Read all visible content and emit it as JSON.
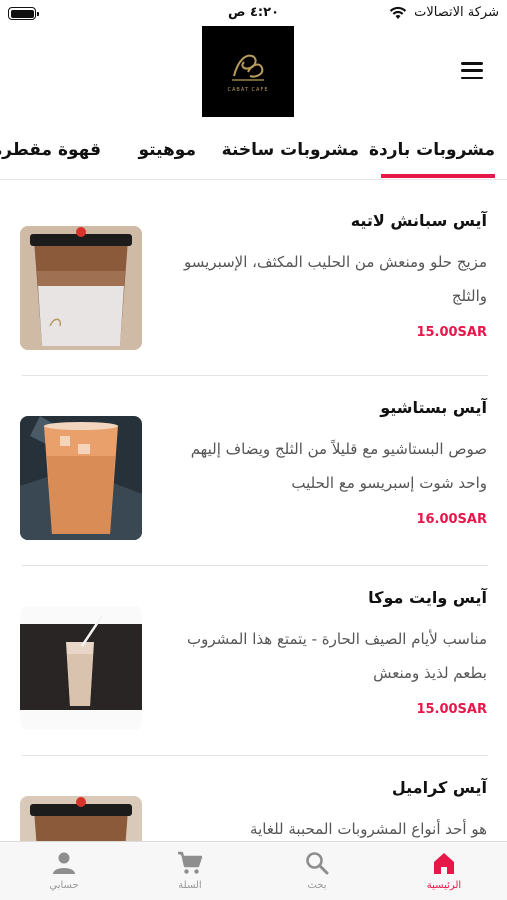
{
  "status_bar": {
    "carrier": "شركة الاتصالات",
    "time": "٤:٢٠ ص"
  },
  "header": {
    "logo_text": "CABAT CAFE",
    "menu_icon": "hamburger-menu-icon"
  },
  "tabs": [
    {
      "label": "مشروبات باردة",
      "active": true
    },
    {
      "label": "مشروبات ساخنة",
      "active": false
    },
    {
      "label": "موهيتو",
      "active": false
    },
    {
      "label": "قهوة مقطرة",
      "active": false
    }
  ],
  "products": [
    {
      "title": "آيس سبانش لاتيه",
      "description": "مزيج حلو ومنعش من الحليب المكثف، الإسبريسو والثلج",
      "price": "15.00SAR"
    },
    {
      "title": "آيس بستاشيو",
      "description": "صوص البستاشيو مع قليلاً من الثلج ويضاف إليهم واحد شوت إسبريسو مع الحليب",
      "price": "16.00SAR"
    },
    {
      "title": "آيس وايت موكا",
      "description": "مناسب لأيام الصيف الحارة - يتمتع هذا المشروب بطعم لذيذ ومنعش",
      "price": "15.00SAR"
    },
    {
      "title": "آيس كراميل",
      "description": "هو أحد أنواع المشروبات المحببة للغاية",
      "price": ""
    }
  ],
  "bottom_nav": [
    {
      "label": "الرئيسية",
      "icon": "home-icon",
      "active": true
    },
    {
      "label": "بحث",
      "icon": "search-icon",
      "active": false
    },
    {
      "label": "السلة",
      "icon": "cart-icon",
      "active": false
    },
    {
      "label": "حسابي",
      "icon": "user-icon",
      "active": false
    }
  ],
  "colors": {
    "accent": "#e8174a",
    "text": "#111111",
    "muted": "#555555"
  }
}
